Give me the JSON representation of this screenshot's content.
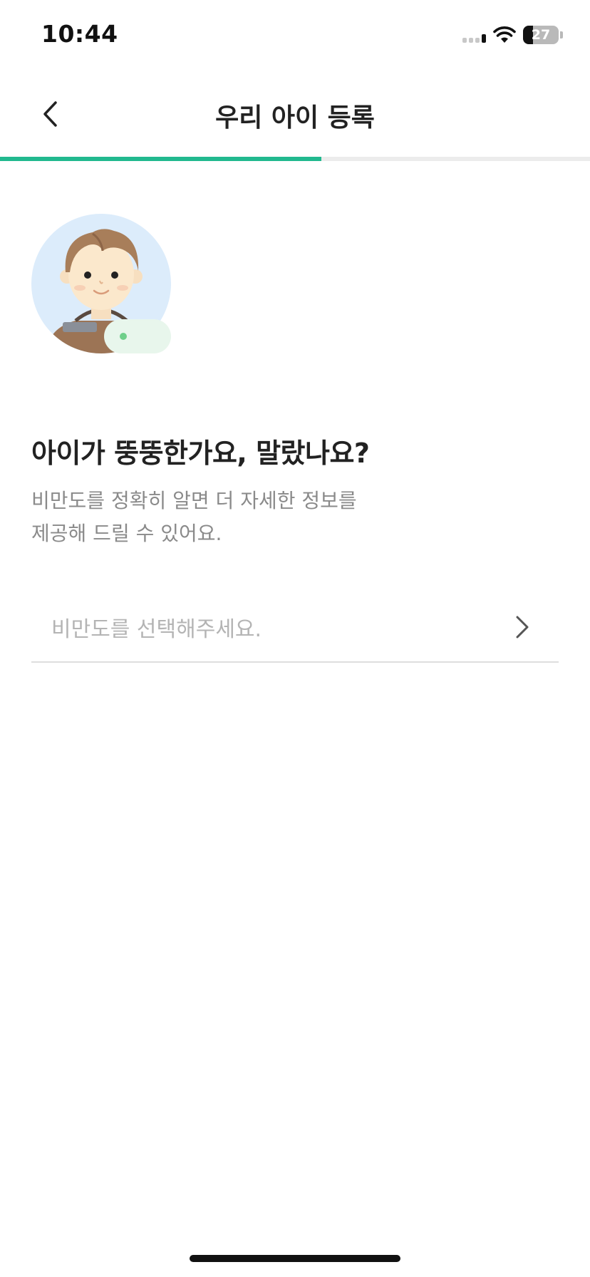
{
  "status_bar": {
    "time": "10:44",
    "battery_level": "27",
    "icons": [
      "cellular-signal-icon",
      "wifi-icon",
      "battery-icon"
    ]
  },
  "header": {
    "title": "우리 아이 등록",
    "back_icon": "chevron-left-icon"
  },
  "progress": {
    "fraction": 0.545,
    "color": "#21b98f",
    "track_color": "#ececec"
  },
  "avatar": {
    "icon": "child-avatar-icon",
    "badge_color": "#6fcf8a"
  },
  "content": {
    "question": "아이가 뚱뚱한가요, 말랐나요?",
    "description_line1": "비만도를 정확히 알면 더 자세한 정보를",
    "description_line2": "제공해 드릴 수 있어요."
  },
  "obesity_select": {
    "placeholder": "비만도를 선택해주세요.",
    "icon": "chevron-right-icon"
  }
}
